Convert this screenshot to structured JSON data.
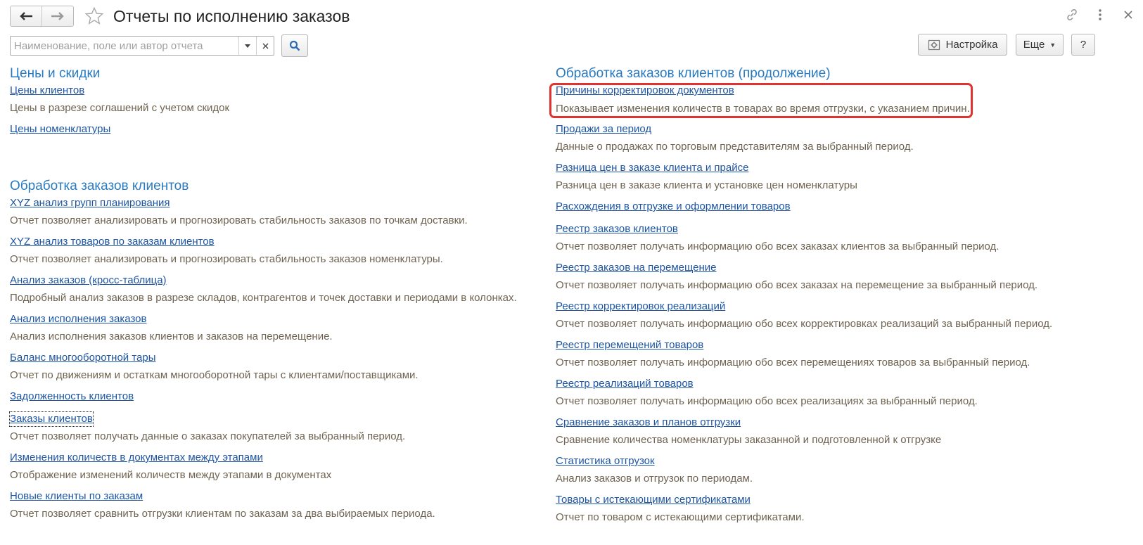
{
  "window": {
    "title": "Отчеты по исполнению заказов"
  },
  "search": {
    "placeholder": "Наименование, поле или автор отчета",
    "value": ""
  },
  "toolbar": {
    "settings_label": "Настройка",
    "more_label": "Еще",
    "help_label": "?"
  },
  "icons": [
    "back-arrow-icon",
    "forward-arrow-icon",
    "star-icon",
    "link-icon",
    "kebab-menu-icon",
    "close-icon",
    "dropdown-icon",
    "clear-icon",
    "search-icon",
    "settings-icon"
  ],
  "left_column": {
    "section1": {
      "title": "Цены и скидки",
      "items": [
        {
          "link": "Цены клиентов",
          "desc": "Цены в разрезе соглашений с учетом скидок"
        },
        {
          "link": "Цены номенклатуры",
          "desc": ""
        }
      ]
    },
    "section2": {
      "title": "Обработка заказов клиентов",
      "items": [
        {
          "link": "XYZ анализ групп планирования",
          "desc": "Отчет позволяет анализировать и прогнозировать стабильность заказов по точкам доставки."
        },
        {
          "link": "XYZ анализ товаров по заказам клиентов",
          "desc": "Отчет позволяет анализировать и прогнозировать стабильность заказов номенклатуры."
        },
        {
          "link": "Анализ заказов (кросс-таблица)",
          "desc": "Подробный анализ заказов в разрезе складов, контрагентов и точек доставки и периодами в колонках."
        },
        {
          "link": "Анализ исполнения заказов",
          "desc": "Анализ исполнения заказов клиентов и заказов на перемещение."
        },
        {
          "link": "Баланс многооборотной тары",
          "desc": "Отчет по движениям и остаткам многооборотной тары с клиентами/поставщиками."
        },
        {
          "link": "Задолженность клиентов",
          "desc": ""
        },
        {
          "link": "Заказы клиентов",
          "desc": "Отчет позволяет получать данные о заказах покупателей за выбранный период."
        },
        {
          "link": "Изменения количеств в документах между этапами",
          "desc": "Отображение изменений количеств между этапами в документах"
        },
        {
          "link": "Новые клиенты по заказам",
          "desc": "Отчет позволяет сравнить отгрузки клиентам по заказам за два выбираемых периода."
        }
      ]
    }
  },
  "right_column": {
    "title": "Обработка заказов клиентов (продолжение)",
    "items": [
      {
        "link": "Причины корректировок документов",
        "desc": "Показывает изменения количеств в товарах во время отгрузки, с указанием причин."
      },
      {
        "link": "Продажи за период",
        "desc": "Данные о продажах по торговым представителям за выбранный период."
      },
      {
        "link": "Разница цен в заказе клиента и прайсе",
        "desc": "Разница цен в заказе клиента и установке цен номенклатуры"
      },
      {
        "link": "Расхождения в отгрузке и оформлении товаров",
        "desc": ""
      },
      {
        "link": "Реестр заказов клиентов",
        "desc": "Отчет позволяет получать информацию обо всех заказах клиентов за выбранный период."
      },
      {
        "link": "Реестр заказов на перемещение",
        "desc": "Отчет позволяет получать информацию обо всех заказах на перемещение за выбранный период."
      },
      {
        "link": "Реестр корректировок реализаций",
        "desc": "Отчет позволяет получать информацию обо всех корректировках реализаций за выбранный период."
      },
      {
        "link": "Реестр перемещений товаров",
        "desc": "Отчет позволяет получать информацию обо всех перемещениях товаров за выбранный период."
      },
      {
        "link": "Реестр реализаций товаров",
        "desc": "Отчет позволяет получать информацию обо всех реализациях за выбранный период."
      },
      {
        "link": "Сравнение заказов и планов отгрузки",
        "desc": "Сравнение количества номенклатуры заказанной и подготовленной к отгрузке"
      },
      {
        "link": "Статистика отгрузок",
        "desc": "Анализ заказов и отгрузок по периодам."
      },
      {
        "link": "Товары с истекающими сертификатами",
        "desc": "Отчет по товаром с истекающими сертификатами."
      }
    ]
  },
  "colors": {
    "section_title": "#2a7ac0",
    "link": "#1d55a4",
    "description": "#6f6351",
    "highlight": "#e0322f"
  }
}
